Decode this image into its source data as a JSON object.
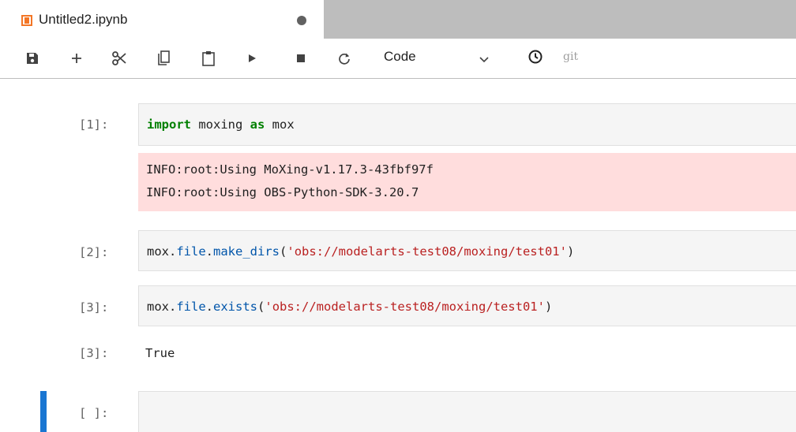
{
  "tab": {
    "title": "Untitled2.ipynb"
  },
  "toolbar": {
    "icons": [
      "save-icon",
      "add-cell-icon",
      "cut-icon",
      "copy-icon",
      "paste-icon",
      "run-icon",
      "stop-icon",
      "restart-icon"
    ],
    "cell_type": "Code",
    "git_label": "git"
  },
  "cells": [
    {
      "prompt": "[1]:",
      "code": {
        "kw1": "import",
        "t1": " moxing ",
        "kw2": "as",
        "t2": " mox"
      },
      "stderr": [
        "INFO:root:Using MoXing-v1.17.3-43fbf97f",
        "INFO:root:Using OBS-Python-SDK-3.20.7"
      ]
    },
    {
      "prompt": "[2]:",
      "code": {
        "obj": "mox",
        "dot1": ".",
        "attr": "file",
        "dot2": ".",
        "fn": "make_dirs",
        "open": "(",
        "arg": "'obs://modelarts-test08/moxing/test01'",
        "close": ")"
      }
    },
    {
      "prompt": "[3]:",
      "code": {
        "obj": "mox",
        "dot1": ".",
        "attr": "file",
        "dot2": ".",
        "fn": "exists",
        "open": "(",
        "arg": "'obs://modelarts-test08/moxing/test01'",
        "close": ")"
      },
      "output_prompt": "[3]:",
      "output": "True"
    },
    {
      "prompt": "[ ]:"
    }
  ],
  "colors": {
    "accent": "#1976d2",
    "stderr_bg": "#ffdddd",
    "keyword": "#008000",
    "string": "#ba2121",
    "tab_icon": "#f37626"
  }
}
